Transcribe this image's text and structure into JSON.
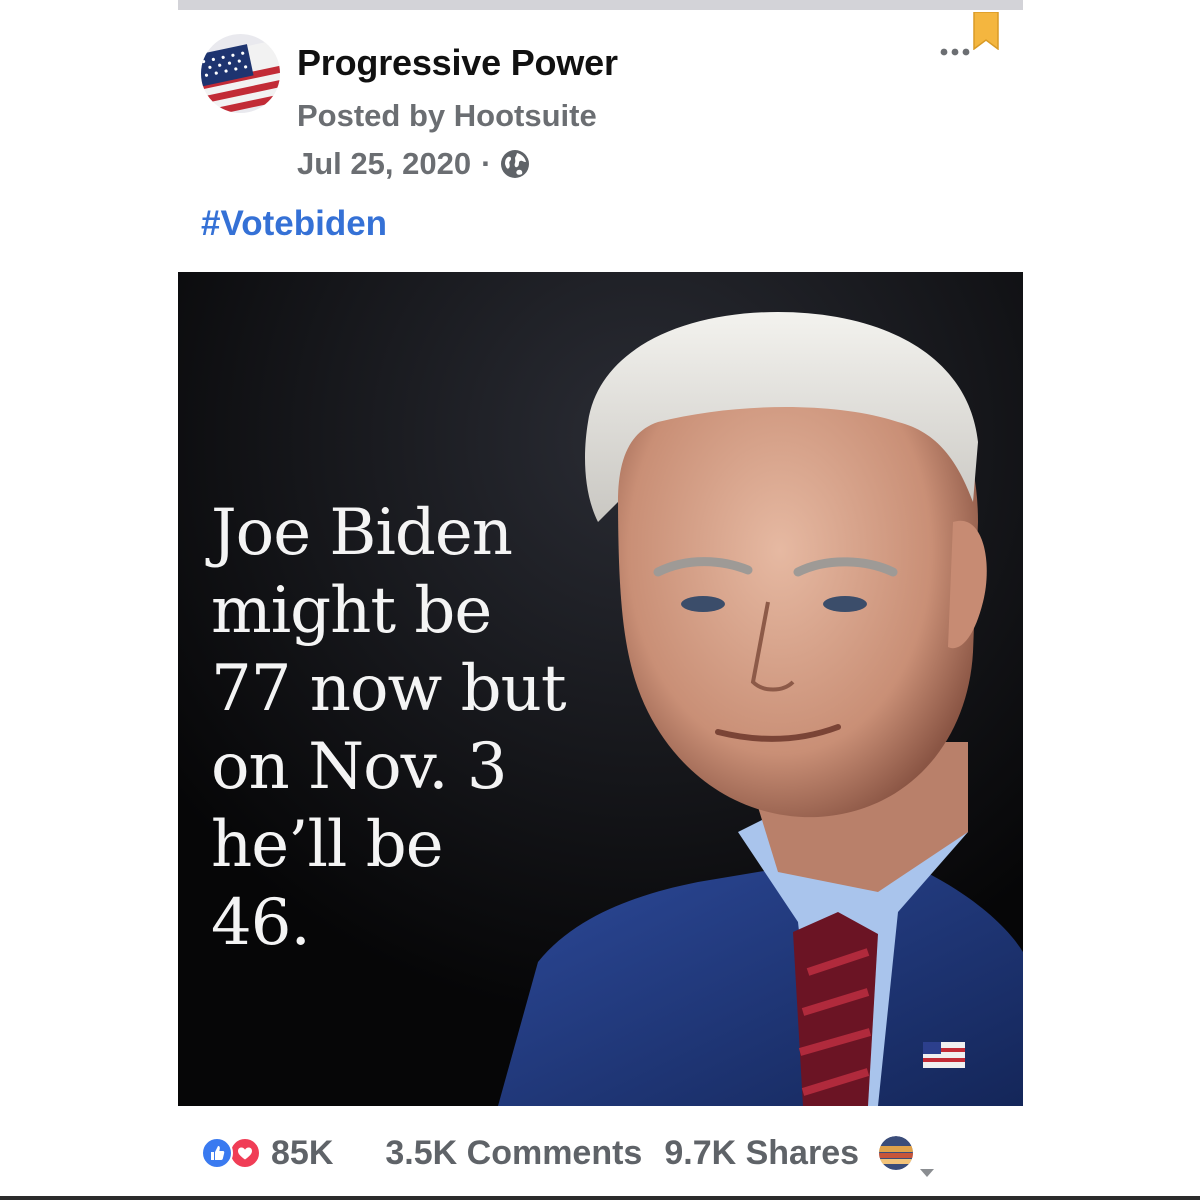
{
  "post": {
    "page_name": "Progressive Power",
    "posted_by": "Posted by Hootsuite",
    "date": "Jul 25, 2020",
    "separator": "·",
    "privacy_icon": "globe-icon",
    "hashtag": "#Votebiden",
    "more_icon": "more-horizontal-icon",
    "bookmark_icon": "bookmark-icon",
    "image_caption": "Joe Biden\nmight be\n77 now but\non Nov. 3\nhe’ll be\n46."
  },
  "stats": {
    "reactions_count": "85K",
    "comments": "3.5K Comments",
    "shares": "9.7K Shares"
  },
  "colors": {
    "hashtag": "#3571d6",
    "meta_text": "#6b6e72",
    "like": "#3a7af0",
    "love": "#f03d56",
    "image_bg": "#060607"
  }
}
